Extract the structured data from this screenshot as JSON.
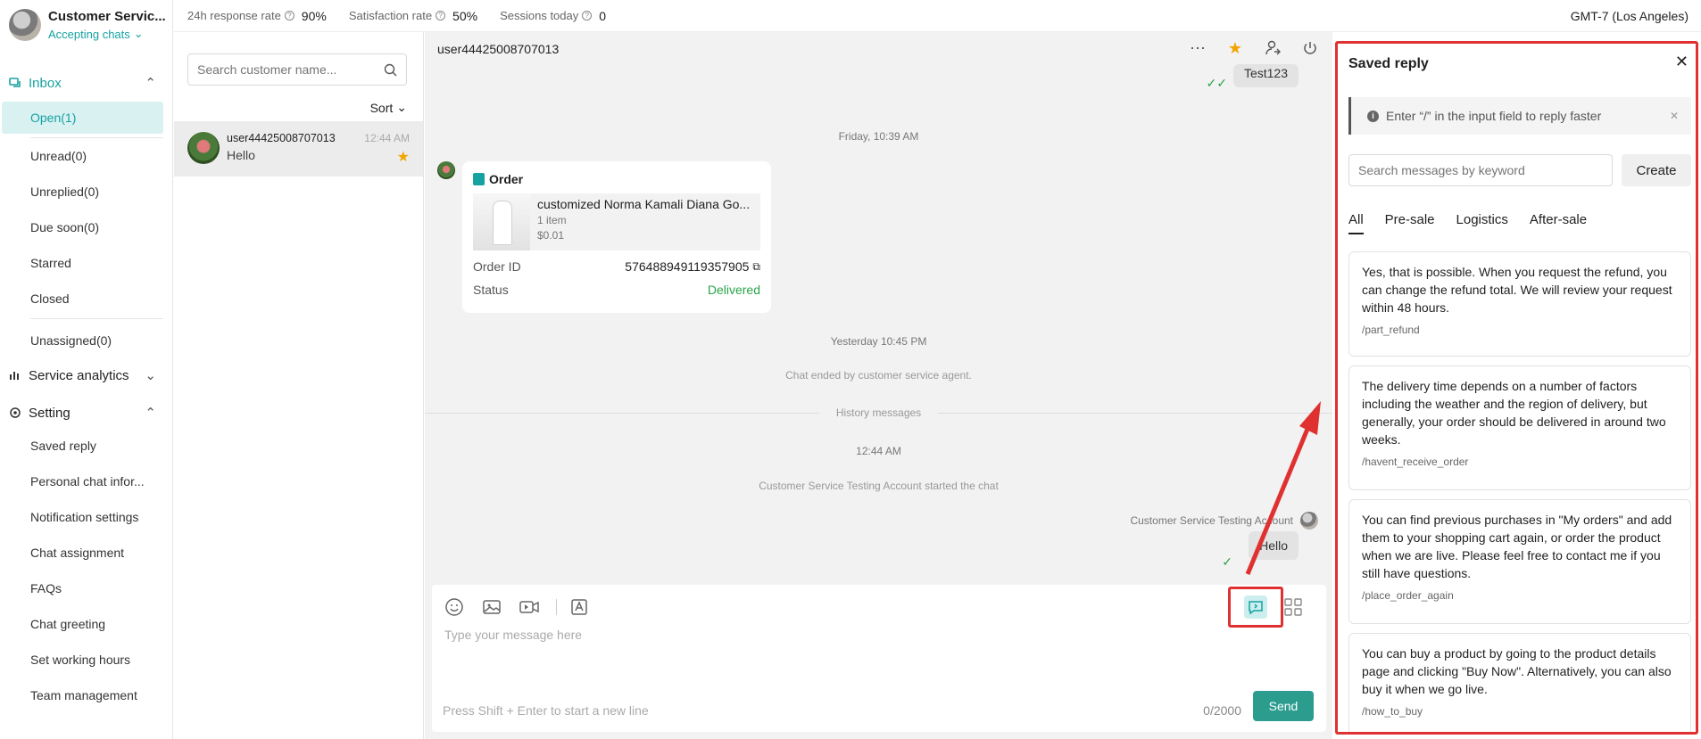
{
  "profile": {
    "name": "Customer Servic...",
    "status": "Accepting chats"
  },
  "nav": {
    "inbox_label": "Inbox",
    "inbox_items": [
      "Open(1)",
      "Unread(0)",
      "Unreplied(0)",
      "Due soon(0)",
      "Starred",
      "Closed"
    ],
    "unassigned": "Unassigned(0)",
    "analytics_label": "Service analytics",
    "setting_label": "Setting",
    "setting_items": [
      "Saved reply",
      "Personal chat infor...",
      "Notification settings",
      "Chat assignment",
      "FAQs",
      "Chat greeting",
      "Set working hours",
      "Team management"
    ]
  },
  "topbar": {
    "metrics": [
      {
        "label": "24h response rate",
        "value": "90%"
      },
      {
        "label": "Satisfaction rate",
        "value": "50%"
      },
      {
        "label": "Sessions today",
        "value": "0"
      }
    ],
    "timezone": "GMT-7 (Los Angeles)"
  },
  "convlist": {
    "search_placeholder": "Search customer name...",
    "sort_label": "Sort",
    "item": {
      "name": "user44425008707013",
      "time": "12:44 AM",
      "message": "Hello"
    }
  },
  "chat": {
    "title": "user44425008707013",
    "messages": {
      "test_bubble": "Test123",
      "friday_time": "Friday, 10:39 AM",
      "order_title": "Order",
      "product_name": "customized Norma Kamali Diana Go...",
      "product_qty": "1 item",
      "product_price": "$0.01",
      "order_id_label": "Order ID",
      "order_id": "576488949119357905",
      "status_label": "Status",
      "status_value": "Delivered",
      "yesterday_time": "Yesterday 10:45 PM",
      "chat_ended": "Chat ended by customer service agent.",
      "history": "History messages",
      "time_1244": "12:44 AM",
      "started": "Customer Service Testing Account started the chat",
      "sender": "Customer Service Testing Account",
      "hello_bubble": "Hello"
    },
    "composer": {
      "placeholder": "Type your message here",
      "hint": "Press Shift + Enter to start a new line",
      "counter": "0/2000",
      "send_label": "Send"
    }
  },
  "saved_reply": {
    "title": "Saved reply",
    "tip": "Enter “/” in the input field to reply faster",
    "search_placeholder": "Search messages by keyword",
    "create_label": "Create",
    "tabs": [
      "All",
      "Pre-sale",
      "Logistics",
      "After-sale"
    ],
    "replies": [
      {
        "text": "Yes, that is possible. When you request the refund, you can change the refund total. We will review your request within 48 hours.",
        "code": "/part_refund"
      },
      {
        "text": "The delivery time depends on a number of factors including the weather and the region of delivery, but generally, your order should be delivered in around two weeks.",
        "code": "/havent_receive_order"
      },
      {
        "text": "You can find previous purchases in \"My orders\" and add them to your shopping cart again, or order the product when we are live. Please feel free to contact me if you still have questions.",
        "code": "/place_order_again"
      },
      {
        "text": "You can buy a product by going to the product details page and clicking \"Buy Now\". Alternatively, you can also buy it when we go live.",
        "code": "/how_to_buy"
      }
    ]
  },
  "colors": {
    "accent": "#17a2a2",
    "send": "#2c9c8f",
    "highlight": "#e03131",
    "star": "#f0a500",
    "delivered": "#2aa54a"
  }
}
